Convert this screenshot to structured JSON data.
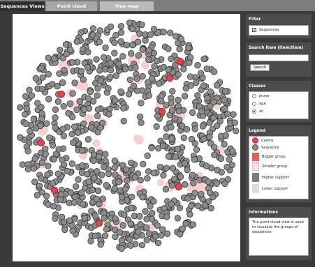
{
  "tabs": {
    "sequences_views": "Sequences Views",
    "point_cloud": "Point cloud",
    "tree_map": "Tree map"
  },
  "filter": {
    "title": "Filter",
    "sequences_label": "Sequences",
    "sequences_checked": true
  },
  "search": {
    "title": "Search Item (item/item)",
    "input_value": "",
    "button_label": "Search"
  },
  "classes": {
    "title": "Classes",
    "options": [
      "jeune",
      "age",
      "all"
    ],
    "selected": "all"
  },
  "legend": {
    "title": "Legend",
    "items": [
      {
        "label": "Centre",
        "color": "#e0454f",
        "shape": "circle"
      },
      {
        "label": "Sequence",
        "color": "#8f8f8f",
        "shape": "circle"
      },
      {
        "label": "Bigger group",
        "color": "#e85c5c",
        "shape": "square"
      },
      {
        "label": "Smaller group",
        "color": "#fbe3e3",
        "shape": "square"
      },
      {
        "label": "Higher support",
        "color": "#7d7d7d",
        "shape": "square"
      },
      {
        "label": "Lower support",
        "color": "#dcdcdc",
        "shape": "square"
      }
    ]
  },
  "informations": {
    "title": "Informations",
    "text": "The point cloud view is used to visualize the groups of sequences"
  },
  "colors": {
    "centre": "#e0454f",
    "sequence": "#8c8c8c",
    "sequence_stroke": "#2b2b2b",
    "group_halo": "#f7cfcf",
    "panel_bg": "#4c4c4c",
    "app_bg": "#3a3a3a"
  }
}
